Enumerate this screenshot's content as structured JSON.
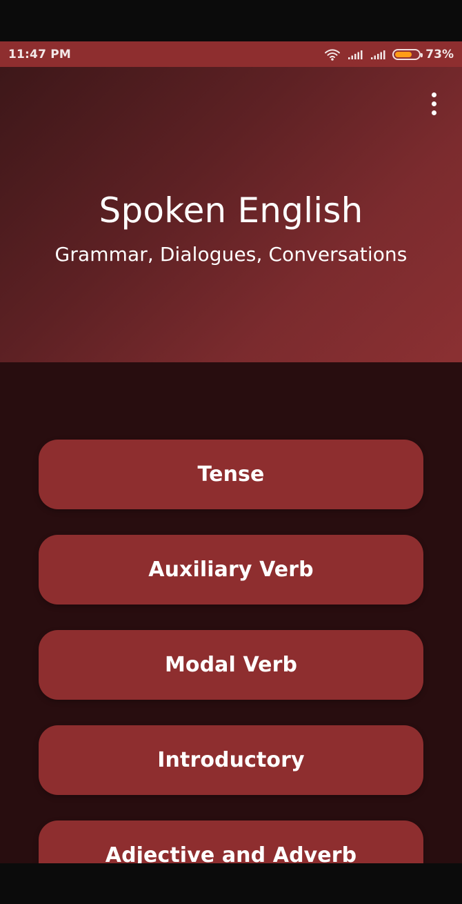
{
  "colors": {
    "status_bar": "#8e2e2f",
    "hero_gradient_start": "#3d1719",
    "hero_gradient_end": "#8b3032",
    "content_background": "#280d0f",
    "button_background": "#8e2e2f",
    "battery_fill": "#ff9d17",
    "text": "#ffffff"
  },
  "status": {
    "time": "11:47 PM",
    "battery_percent": "73%",
    "battery_level": 0.73,
    "icons": [
      "wifi-icon",
      "signal-icon",
      "signal-icon",
      "battery-icon"
    ]
  },
  "header": {
    "menu_icon": "more-vertical-icon",
    "title": "Spoken English",
    "subtitle": "Grammar, Dialogues, Conversations"
  },
  "topics": [
    {
      "label": "Tense"
    },
    {
      "label": "Auxiliary Verb"
    },
    {
      "label": "Modal Verb"
    },
    {
      "label": "Introductory"
    },
    {
      "label": "Adjective and Adverb"
    }
  ]
}
